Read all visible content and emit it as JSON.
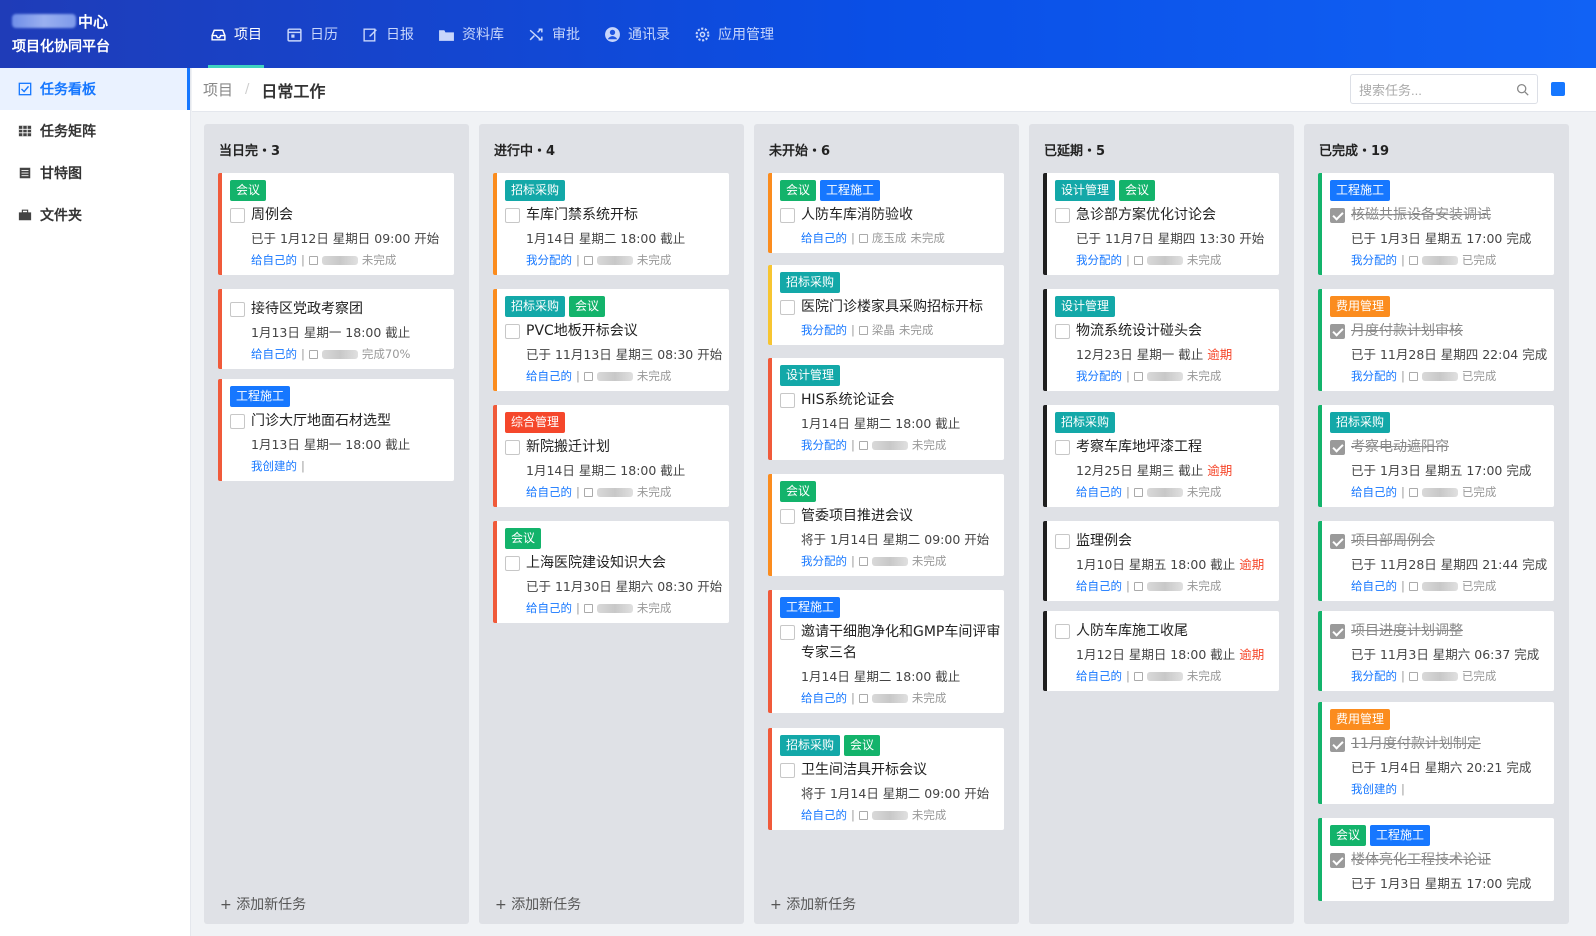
{
  "brand": {
    "org_suffix": "中心",
    "system": "项目化协同平台"
  },
  "nav": [
    {
      "label": "项目",
      "icon": "inbox-icon",
      "active": true
    },
    {
      "label": "日历",
      "icon": "calendar-icon"
    },
    {
      "label": "日报",
      "icon": "edit-icon"
    },
    {
      "label": "资料库",
      "icon": "folder-icon"
    },
    {
      "label": "审批",
      "icon": "shuffle-icon"
    },
    {
      "label": "通讯录",
      "icon": "user-circle-icon"
    },
    {
      "label": "应用管理",
      "icon": "settings-icon"
    }
  ],
  "sidebar": [
    {
      "label": "任务看板",
      "icon": "check-square-icon",
      "active": true
    },
    {
      "label": "任务矩阵",
      "icon": "grid-icon"
    },
    {
      "label": "甘特图",
      "icon": "list-icon"
    },
    {
      "label": "文件夹",
      "icon": "briefcase-icon"
    }
  ],
  "breadcrumb": {
    "root": "项目",
    "sep": "/",
    "current": "日常工作"
  },
  "search": {
    "placeholder": "搜索任务..."
  },
  "board": {
    "add_label": "添加新任务",
    "columns": [
      {
        "title": "当日完・3",
        "cards": [
          {
            "tags": [
              {
                "t": "会议",
                "c": "green"
              }
            ],
            "title": "周例会",
            "line2": "已于 1月12日 星期日 09:00 开始",
            "who": "给自己的",
            "status": "未完成"
          },
          {
            "tags": [],
            "title": "接待区党政考察团",
            "line2": "1月13日 星期一 18:00 截止",
            "who": "给自己的",
            "status": "完成70%"
          },
          {
            "tags": [
              {
                "t": "工程施工",
                "c": "blue"
              }
            ],
            "title": "门诊大厅地面石材选型",
            "line2": "1月13日 星期一 18:00 截止",
            "who": "我创建的",
            "status": ""
          }
        ]
      },
      {
        "title": "进行中・4",
        "cards": [
          {
            "tags": [
              {
                "t": "招标采购",
                "c": "teal"
              }
            ],
            "title": "车库门禁系统开标",
            "line2": "1月14日 星期二 18:00 截止",
            "who": "我分配的",
            "status": "未完成"
          },
          {
            "tags": [
              {
                "t": "招标采购",
                "c": "teal"
              },
              {
                "t": "会议",
                "c": "green"
              }
            ],
            "title": "PVC地板开标会议",
            "line2": "已于 11月13日 星期三 08:30 开始",
            "who": "给自己的",
            "status": "未完成"
          },
          {
            "tags": [
              {
                "t": "综合管理",
                "c": "red"
              }
            ],
            "title": "新院搬迁计划",
            "line2": "1月14日 星期二 18:00 截止",
            "who": "给自己的",
            "status": "未完成"
          },
          {
            "tags": [
              {
                "t": "会议",
                "c": "green"
              }
            ],
            "title": "上海医院建设知识大会",
            "line2": "已于 11月30日 星期六 08:30 开始",
            "who": "给自己的",
            "status": "未完成"
          }
        ]
      },
      {
        "title": "未开始・6",
        "cards": [
          {
            "tags": [
              {
                "t": "会议",
                "c": "green"
              },
              {
                "t": "工程施工",
                "c": "blue"
              }
            ],
            "title": "人防车库消防验收",
            "line2": "",
            "who": "给自己的",
            "assignee": "庞玉成",
            "status": "未完成"
          },
          {
            "tags": [
              {
                "t": "招标采购",
                "c": "teal"
              }
            ],
            "title": "医院门诊楼家具采购招标开标",
            "line2": "",
            "who": "我分配的",
            "assignee": "梁晶",
            "status": "未完成"
          },
          {
            "tags": [
              {
                "t": "设计管理",
                "c": "teal"
              }
            ],
            "title": "HIS系统论证会",
            "line2": "1月14日 星期二 18:00 截止",
            "who": "我分配的",
            "status": "未完成"
          },
          {
            "tags": [
              {
                "t": "会议",
                "c": "green"
              }
            ],
            "title": "管委项目推进会议",
            "line2": "将于 1月14日 星期二 09:00 开始",
            "who": "我分配的",
            "status": "未完成"
          },
          {
            "tags": [
              {
                "t": "工程施工",
                "c": "blue"
              }
            ],
            "title": "邀请干细胞净化和GMP车间评审专家三名",
            "line2": "1月14日 星期二 18:00 截止",
            "who": "给自己的",
            "status": "未完成"
          },
          {
            "tags": [
              {
                "t": "招标采购",
                "c": "teal"
              },
              {
                "t": "会议",
                "c": "green"
              }
            ],
            "title": "卫生间洁具开标会议",
            "line2": "将于 1月14日 星期二 09:00 开始",
            "who": "给自己的",
            "status": "未完成"
          }
        ]
      },
      {
        "title": "已延期・5",
        "cards": [
          {
            "tags": [
              {
                "t": "设计管理",
                "c": "teal"
              },
              {
                "t": "会议",
                "c": "green"
              }
            ],
            "title": "急诊部方案优化讨论会",
            "line2": "已于 11月7日 星期四 13:30 开始",
            "who": "我分配的",
            "status": "未完成"
          },
          {
            "tags": [
              {
                "t": "设计管理",
                "c": "teal"
              }
            ],
            "title": "物流系统设计碰头会",
            "line2": "12月23日 星期一 截止",
            "overdue": "逾期",
            "who": "我分配的",
            "status": "未完成"
          },
          {
            "tags": [
              {
                "t": "招标采购",
                "c": "teal"
              }
            ],
            "title": "考察车库地坪漆工程",
            "line2": "12月25日 星期三 截止",
            "overdue": "逾期",
            "who": "给自己的",
            "status": "未完成"
          },
          {
            "tags": [],
            "title": "监理例会",
            "line2": "1月10日 星期五 18:00 截止",
            "overdue": "逾期",
            "who": "给自己的",
            "status": "未完成"
          },
          {
            "tags": [],
            "title": "人防车库施工收尾",
            "line2": "1月12日 星期日 18:00 截止",
            "overdue": "逾期",
            "who": "给自己的",
            "status": "未完成"
          }
        ]
      },
      {
        "title": "已完成・19",
        "cards": [
          {
            "tags": [
              {
                "t": "工程施工",
                "c": "blue"
              }
            ],
            "title": "核磁共振设备安装调试",
            "line2": "已于 1月3日 星期五 17:00 完成",
            "who": "我分配的",
            "status": "已完成"
          },
          {
            "tags": [
              {
                "t": "费用管理",
                "c": "orange"
              }
            ],
            "title": "月度付款计划审核",
            "line2": "已于 11月28日 星期四 22:04 完成",
            "who": "我分配的",
            "status": "已完成"
          },
          {
            "tags": [
              {
                "t": "招标采购",
                "c": "teal"
              }
            ],
            "title": "考察电动遮阳帘",
            "line2": "已于 1月3日 星期五 17:00 完成",
            "who": "给自己的",
            "status": "已完成"
          },
          {
            "tags": [],
            "title": "项目部周例会",
            "line2": "已于 11月28日 星期四 21:44 完成",
            "who": "给自己的",
            "status": "已完成"
          },
          {
            "tags": [],
            "title": "项目进度计划调整",
            "line2": "已于 11月3日 星期六 06:37 完成",
            "who": "我分配的",
            "status": "已完成"
          },
          {
            "tags": [
              {
                "t": "费用管理",
                "c": "orange"
              }
            ],
            "title": "11月度付款计划制定",
            "line2": "已于 1月4日 星期六 20:21 完成",
            "who": "我创建的",
            "status": ""
          },
          {
            "tags": [
              {
                "t": "会议",
                "c": "green"
              },
              {
                "t": "工程施工",
                "c": "blue"
              }
            ],
            "title": "楼体亮化工程技术论证",
            "line2": "已于 1月3日 星期五 17:00 完成",
            "who": "",
            "status": ""
          }
        ]
      }
    ]
  }
}
